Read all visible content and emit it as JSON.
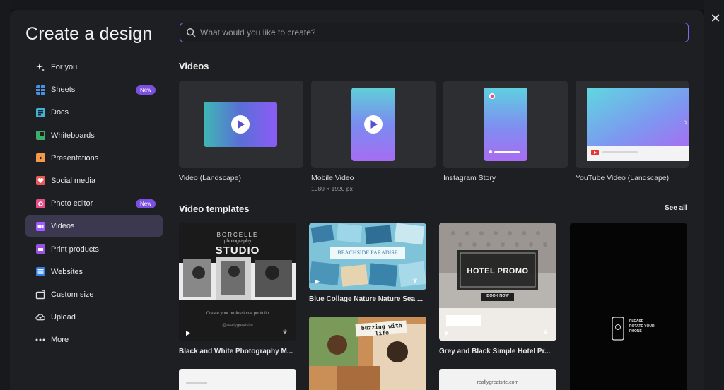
{
  "modal": {
    "title": "Create a design",
    "close_glyph": "✕"
  },
  "search": {
    "placeholder": "What would you like to create?"
  },
  "sidebar": {
    "items": [
      {
        "label": "For you",
        "icon": "sparkle-icon",
        "color": "#ffffff"
      },
      {
        "label": "Sheets",
        "icon": "sheets-icon",
        "color": "#4a90e2",
        "badge": "New"
      },
      {
        "label": "Docs",
        "icon": "docs-icon",
        "color": "#3fb4d6"
      },
      {
        "label": "Whiteboards",
        "icon": "whiteboard-icon",
        "color": "#3caf6a"
      },
      {
        "label": "Presentations",
        "icon": "presentation-icon",
        "color": "#f2994a"
      },
      {
        "label": "Social media",
        "icon": "heart-icon",
        "color": "#eb5757"
      },
      {
        "label": "Photo editor",
        "icon": "photo-editor-icon",
        "color": "#e84d8a",
        "badge": "New"
      },
      {
        "label": "Videos",
        "icon": "video-icon",
        "color": "#a259ff",
        "active": true
      },
      {
        "label": "Print products",
        "icon": "print-icon",
        "color": "#9b51e0"
      },
      {
        "label": "Websites",
        "icon": "website-icon",
        "color": "#2f80ed"
      },
      {
        "label": "Custom size",
        "icon": "custom-size-icon",
        "color": "#e0e0e0"
      },
      {
        "label": "Upload",
        "icon": "upload-icon",
        "color": "#e0e0e0"
      },
      {
        "label": "More",
        "icon": "more-icon",
        "color": "#e0e0e0"
      }
    ]
  },
  "videos": {
    "title": "Videos",
    "cards": [
      {
        "label": "Video (Landscape)",
        "sub": ""
      },
      {
        "label": "Mobile Video",
        "sub": "1080 × 1920 px"
      },
      {
        "label": "Instagram Story",
        "sub": ""
      },
      {
        "label": "YouTube Video (Landscape)",
        "sub": ""
      }
    ]
  },
  "templates": {
    "title": "Video templates",
    "see_all": "See all",
    "items": [
      {
        "label": "Black and White Photography M...",
        "heading_small": "BORCELLE",
        "heading_sub": "photography",
        "heading_big": "STUDIO",
        "caption": "Create your professional portfolio",
        "handle": "@reallygreatsite"
      },
      {
        "label": "Blue Collage Nature Nature Sea ...",
        "banner": "BEACHSIDE PARADISE"
      },
      {
        "label": "Grey and Black Simple Hotel Pr...",
        "heading": "HOTEL PROMO",
        "button": "BOOK NOW"
      },
      {
        "label": "",
        "rotate_text": "PLEASE ROTATE YOUR PHONE"
      },
      {
        "label": "",
        "banner": "buzzing with life"
      },
      {
        "label": "",
        "url": "reallygreatsite.com"
      }
    ]
  },
  "colors": {
    "accent": "#7d6cf0",
    "badge": "#7b4fe0",
    "active_bg": "#3b3850"
  }
}
